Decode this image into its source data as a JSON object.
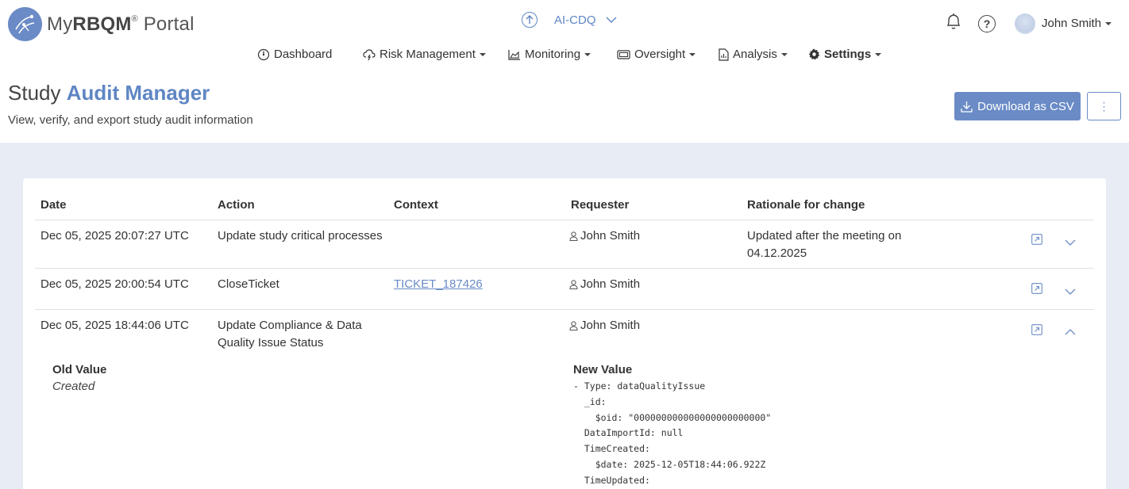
{
  "app": {
    "logo_prefix": "My",
    "logo_bold": "RBQM",
    "logo_reg": "®",
    "logo_suffix": " Portal",
    "study": "AI-CDQ",
    "user_name": "John Smith"
  },
  "nav": {
    "dashboard": "Dashboard",
    "risk": "Risk Management",
    "monitoring": "Monitoring",
    "oversight": "Oversight",
    "analysis": "Analysis",
    "settings": "Settings"
  },
  "page": {
    "title_light": "Study ",
    "title_bold": "Audit Manager",
    "subtitle": "View, verify, and export study audit information",
    "download_label": "Download as CSV",
    "more_label": "⋮"
  },
  "table": {
    "headers": [
      "Date",
      "Action",
      "Context",
      "Requester",
      "Rationale for change"
    ],
    "rows": [
      {
        "date": "Dec 05, 2025 20:07:27 UTC",
        "action": "Update study critical processes",
        "context": "",
        "requester": "John Smith",
        "rationale_line1": "Updated after the meeting on",
        "rationale_line2": "04.12.2025"
      },
      {
        "date": "Dec 05, 2025 20:00:54 UTC",
        "action": "CloseTicket",
        "context": "TICKET_187426",
        "requester": "John Smith",
        "rationale_line1": "",
        "rationale_line2": ""
      },
      {
        "date": "Dec 05, 2025 18:44:06 UTC",
        "action_line1": "Update Compliance & Data",
        "action_line2": "Quality Issue Status",
        "context": "",
        "requester": "John Smith",
        "rationale_line1": "",
        "rationale_line2": ""
      }
    ],
    "detail": {
      "old_label": "Old Value",
      "old_value": "Created",
      "new_label": "New Value",
      "new_lines": [
        "- Type: dataQualityIssue",
        "  _id:",
        "    $oid: \"000000000000000000000000\"",
        "  DataImportId: null",
        "  TimeCreated:",
        "    $date: 2025-12-05T18:44:06.922Z",
        "  TimeUpdated:"
      ]
    }
  },
  "colors": {
    "accent": "#6a8bc6",
    "content_bg": "#e8edf5"
  }
}
